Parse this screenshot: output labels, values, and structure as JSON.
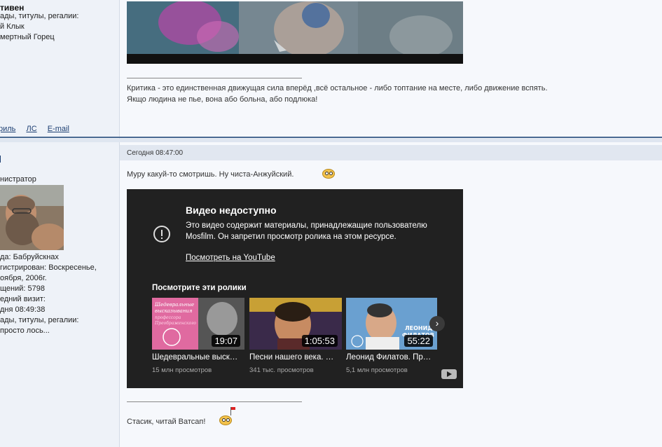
{
  "post1": {
    "author_fragment": "тивен",
    "side_lines": [
      "ады, титулы, регалии:",
      "й Клык",
      "мертный Горец"
    ],
    "signature": [
      "Критика - это единственная движущая сила вперёд ,всё остальное - либо топтание на месте, либо движение вспять.",
      "Якщо людина не пье, вона або больна, або подлюка!"
    ],
    "profile_links": [
      "риль",
      "ЛС",
      "E-mail"
    ]
  },
  "post2": {
    "author_fragment": "",
    "rank": "нистратор",
    "side_lines": [
      "да: Бабруйскнах",
      "гистрирован: Воскресенье,",
      "оября, 2006г.",
      "щений: 5798",
      "едний визит:",
      "дня 08:49:38",
      "ады, титулы, регалии:",
      " просто лось..."
    ],
    "date": "Сегодня 08:47:00",
    "message": "Муру какуй-то смотришь. Ну чиста-Анжуйский.",
    "signature": "Стасик, читай Ватсап!",
    "video": {
      "title": "Видео недоступно",
      "description": "Это видео содержит материалы, принадлежащие пользователю Mosfilm. Он запретил просмотр ролика на этом ресурсе.",
      "watch_link": "Посмотреть на YouTube",
      "more_title": "Посмотрите эти ролики",
      "items": [
        {
          "title": "Шедевральные выск…",
          "views": "15 млн просмотров",
          "duration": "19:07",
          "overlay": "Шедевральные высказывания профессора Преображенского"
        },
        {
          "title": "Песни нашего века. …",
          "views": "341 тыс. просмотров",
          "duration": "1:05:53"
        },
        {
          "title": "Леонид Филатов. Пр…",
          "views": "5,1 млн просмотров",
          "duration": "55:22",
          "overlay": "ЛЕОНИД ФИЛАТОВ"
        }
      ]
    }
  },
  "colors": {
    "link": "#1d3f72",
    "separator": "#4a6a92",
    "player_bg": "#212121"
  }
}
